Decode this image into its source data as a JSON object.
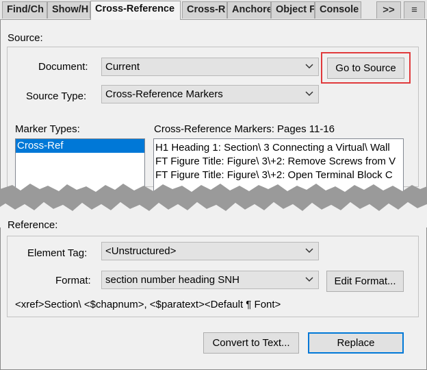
{
  "tabs": [
    {
      "label": "Find/Ch",
      "active": false
    },
    {
      "label": "Show/H",
      "active": false
    },
    {
      "label": "Cross-Reference",
      "active": true
    },
    {
      "label": "Cross-R",
      "active": false
    },
    {
      "label": "Anchore",
      "active": false
    },
    {
      "label": "Object F",
      "active": false
    },
    {
      "label": "Console",
      "active": false
    }
  ],
  "tab_controls": {
    "overflow": ">>",
    "menu": "≡"
  },
  "source": {
    "heading": "Source:",
    "document_label": "Document:",
    "document_value": "Current",
    "goto_button": "Go to Source",
    "source_type_label": "Source Type:",
    "source_type_value": "Cross-Reference Markers",
    "marker_types_label": "Marker Types:",
    "marker_types": [
      "Cross-Ref"
    ],
    "markers_label": "Cross-Reference Markers: Pages  11-16",
    "markers": [
      "H1 Heading 1: Section\\ 3 Connecting a Virtual\\ Wall",
      "FT Figure Title: Figure\\ 3\\+2: Remove Screws from V",
      "FT Figure Title: Figure\\ 3\\+2: Open Terminal Block C"
    ]
  },
  "reference": {
    "heading": "Reference:",
    "element_tag_label": "Element Tag:",
    "element_tag_value": "<Unstructured>",
    "format_label": "Format:",
    "format_value": "section number heading SNH",
    "edit_format_button": "Edit Format...",
    "format_definition": "<xref>Section\\ <$chapnum>, <$paratext><Default ¶ Font>"
  },
  "buttons": {
    "convert": "Convert to Text...",
    "replace": "Replace"
  },
  "colors": {
    "highlight": "#e0393b",
    "selection": "#0078d7"
  }
}
